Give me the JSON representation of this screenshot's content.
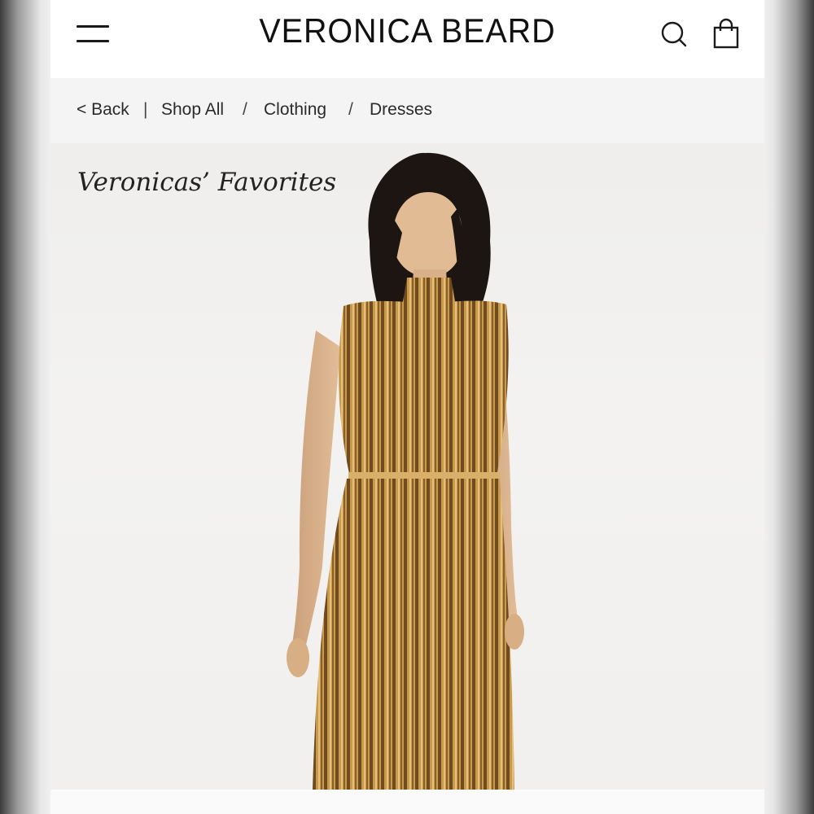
{
  "header": {
    "brand": "VERONICA BEARD",
    "menu_icon": "hamburger-menu-icon",
    "search_icon": "search-icon",
    "bag_icon": "shopping-bag-icon"
  },
  "breadcrumb": {
    "back": "< Back",
    "separator_first": "|",
    "items": [
      "Shop All",
      "Clothing",
      "Dresses"
    ],
    "separator": "/"
  },
  "hero": {
    "title": "Veronicas’ Favorites"
  },
  "colors": {
    "page_bg": "#ffffff",
    "breadcrumb_bg": "#f4f4f4",
    "hero_bg": "#f1f0ee",
    "dress_gold": "#b8893f",
    "dress_dark_stripe": "#6b4a1f"
  }
}
